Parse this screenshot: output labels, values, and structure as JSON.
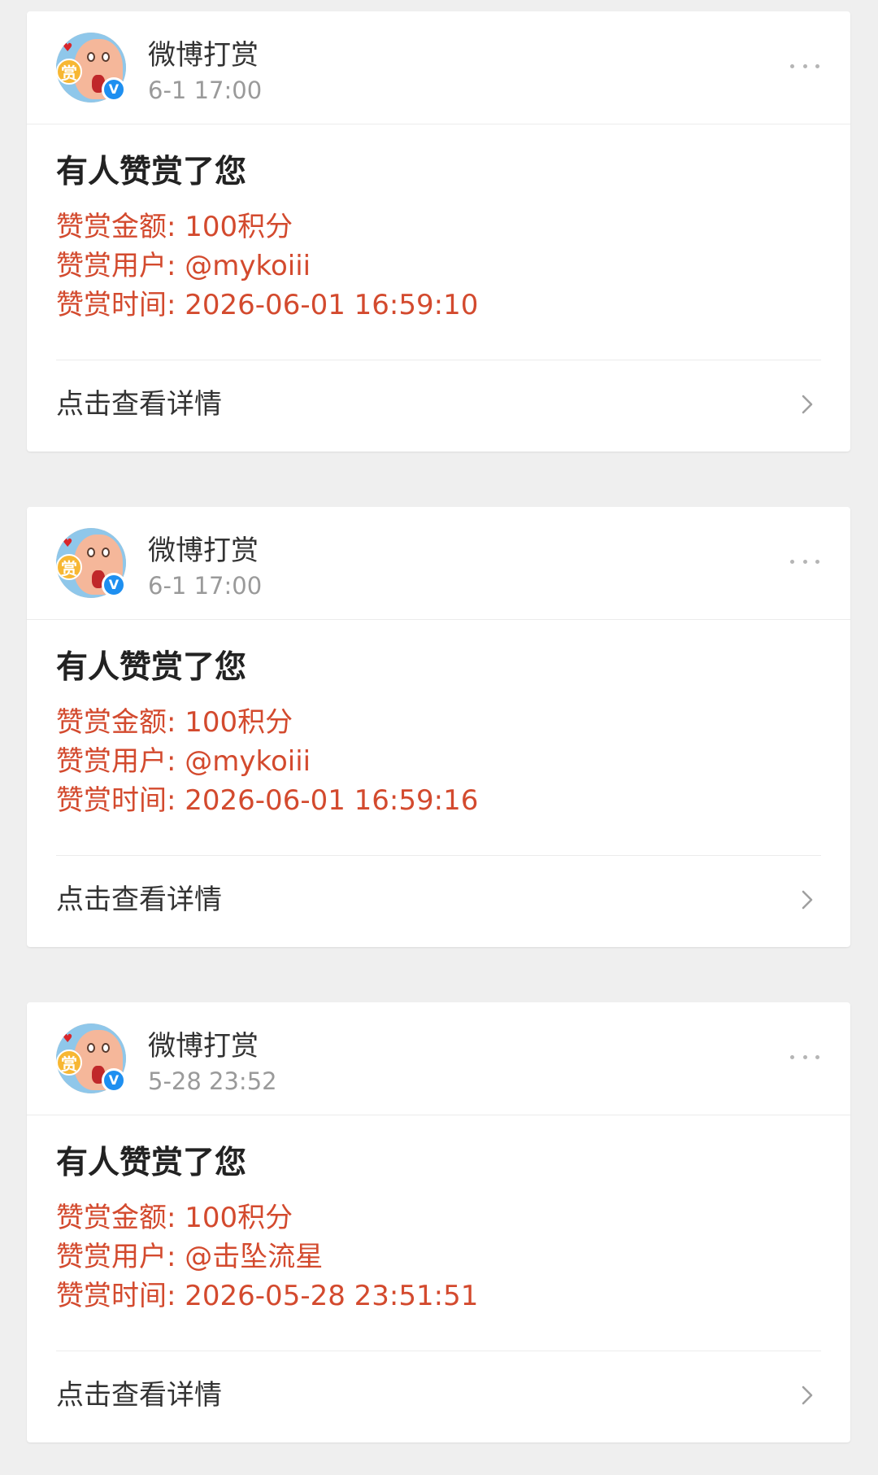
{
  "cards": [
    {
      "sender": "微博打赏",
      "time": "6-1 17:00",
      "heading": "有人赞赏了您",
      "amount": "赞赏金额: 100积分",
      "user": "赞赏用户: @mykoiii",
      "reward_time": "赞赏时间: 2026-06-01 16:59:10",
      "footer": "点击查看详情"
    },
    {
      "sender": "微博打赏",
      "time": "6-1 17:00",
      "heading": "有人赞赏了您",
      "amount": "赞赏金额: 100积分",
      "user": "赞赏用户: @mykoiii",
      "reward_time": "赞赏时间: 2026-06-01 16:59:16",
      "footer": "点击查看详情"
    },
    {
      "sender": "微博打赏",
      "time": "5-28 23:52",
      "heading": "有人赞赏了您",
      "amount": "赞赏金额: 100积分",
      "user": "赞赏用户: @击坠流星",
      "reward_time": "赞赏时间: 2026-05-28 23:51:51",
      "footer": "点击查看详情"
    }
  ],
  "avatar": {
    "badge_text": "赏",
    "verified_mark": "V"
  },
  "colors": {
    "background": "#efefef",
    "card": "#ffffff",
    "detail_text": "#d34a2e",
    "heading_text": "#222222",
    "secondary_text": "#9a9a9a",
    "verified_blue": "#1e8ff0",
    "reward_badge": "#f7b733"
  },
  "icons": {
    "more": "more-horizontal-icon",
    "chevron": "chevron-right-icon",
    "verified": "verified-badge-icon"
  }
}
